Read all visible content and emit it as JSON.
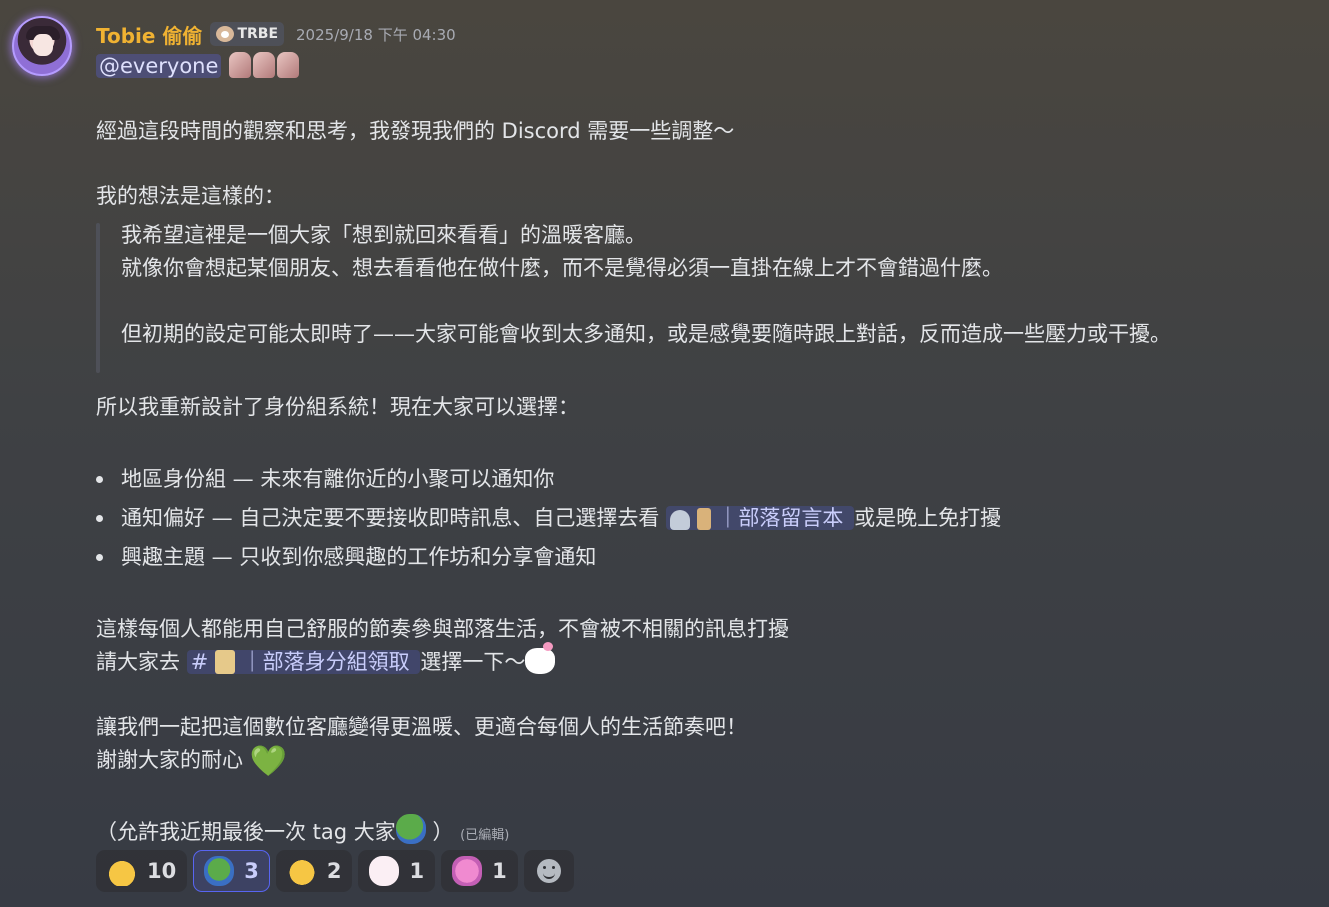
{
  "message": {
    "username": "Tobie 偷偷",
    "tag": "TRBE",
    "timestamp": "2025/9/18 下午 04:30",
    "mention": "@everyone",
    "intro": "經過這段時間的觀察和思考，我發現我們的 Discord 需要一些調整～",
    "idea_heading": "我的想法是這樣的：",
    "quote": [
      "我希望這裡是一個大家「想到就回來看看」的溫暖客廳。",
      "就像你會想起某個朋友、想去看看他在做什麼，而不是覺得必須一直掛在線上才不會錯過什麼。",
      "但初期的設定可能太即時了——大家可能會收到太多通知，或是感覺要隨時跟上對話，反而造成一些壓力或干擾。"
    ],
    "redesign": "所以我重新設計了身份組系統！現在大家可以選擇：",
    "bullets": {
      "b1": "地區身份組 — 未來有離你近的小聚可以通知你",
      "b2_before": "通知偏好 — 自己決定要不要接收即時訊息、自己選擇去看",
      "b2_channel": "｜部落留言本",
      "b2_after": "或是晚上免打擾",
      "b3": "興趣主題 — 只收到你感興趣的工作坊和分享會通知"
    },
    "rhythm": "這樣每個人都能用自己舒服的節奏參與部落生活，不會被不相關的訊息打擾",
    "go_before": "請大家去",
    "go_channel_hash": "#",
    "go_channel": "｜部落身分組領取",
    "go_after": "選擇一下～",
    "closing1": "讓我們一起把這個數位客廳變得更溫暖、更適合每個人的生活節奏吧！",
    "closing2": "謝謝大家的耐心",
    "heart": "💚",
    "footnote": "（允許我近期最後一次 tag 大家",
    "footnote_end": "）",
    "edited": "(已編輯)"
  },
  "reactions": [
    {
      "emoji": "raising-hands",
      "count": "10",
      "active": false
    },
    {
      "emoji": "pepe",
      "count": "3",
      "active": true
    },
    {
      "emoji": "clapping-hands",
      "count": "2",
      "active": false
    },
    {
      "emoji": "cat-heart",
      "count": "1",
      "active": false
    },
    {
      "emoji": "pink-character",
      "count": "1",
      "active": false
    }
  ]
}
